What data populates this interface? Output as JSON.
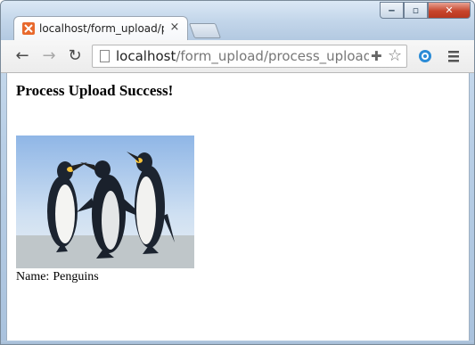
{
  "tab": {
    "title": "localhost/form_upload/pr",
    "close_label": "×"
  },
  "window_controls": {
    "minimize": "‒",
    "maximize": "▫",
    "close": "✕"
  },
  "toolbar": {
    "back": "←",
    "forward": "→",
    "reload": "↻",
    "url_host": "localhost",
    "url_path": "/form_upload/process_upload.php"
  },
  "page": {
    "heading": "Process Upload Success!",
    "name_label": "Name:",
    "name_value": "Penguins"
  },
  "icons": [
    "xampp-favicon",
    "page-icon",
    "puzzle-extension-icon",
    "bookmark-star-icon",
    "extension-icon",
    "menu-icon"
  ],
  "colors": {
    "tab_favicon": "#e8692d",
    "close_button": "#c7452c"
  }
}
